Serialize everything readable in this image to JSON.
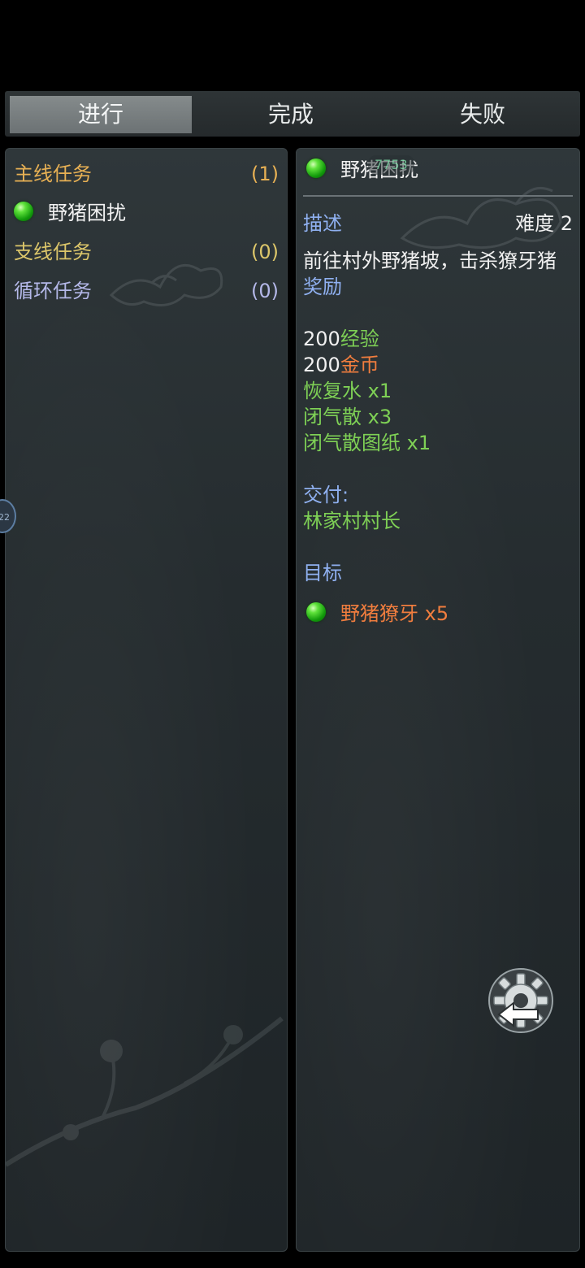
{
  "tabs": [
    {
      "label": "进行",
      "active": true
    },
    {
      "label": "完成",
      "active": false
    },
    {
      "label": "失败",
      "active": false
    }
  ],
  "quest_list": {
    "main": {
      "label": "主线任务",
      "count": "(1)"
    },
    "main_items": [
      {
        "name": "野猪困扰"
      }
    ],
    "side": {
      "label": "支线任务",
      "count": "(0)"
    },
    "loop": {
      "label": "循环任务",
      "count": "(0)"
    }
  },
  "detail": {
    "title": "野猪困扰",
    "overlay_text": "7753",
    "description_label": "描述",
    "difficulty": "难度 2",
    "description": "前往村外野猪坡，击杀獠牙猪",
    "reward_label": "奖励",
    "rewards": [
      {
        "amount": "200",
        "name": "经验"
      },
      {
        "amount": "200",
        "name": "金币"
      }
    ],
    "items": [
      "恢复水 x1",
      "闭气散 x3",
      "闭气散图纸 x1"
    ],
    "deliver_label": "交付:",
    "deliver_to": "林家村村长",
    "objective_label": "目标",
    "objective": "野猪獠牙 x5"
  },
  "side_handle_text": "22",
  "icons": [
    "green-orb-icon",
    "gear-back-icon"
  ],
  "colors": {
    "main_category": "#e7b054",
    "side_category": "#dcc66a",
    "loop_category": "#b4b8e8",
    "section_label": "#8fb0f0",
    "reward_green": "#7ed055",
    "accent_orange": "#f07d3e"
  }
}
